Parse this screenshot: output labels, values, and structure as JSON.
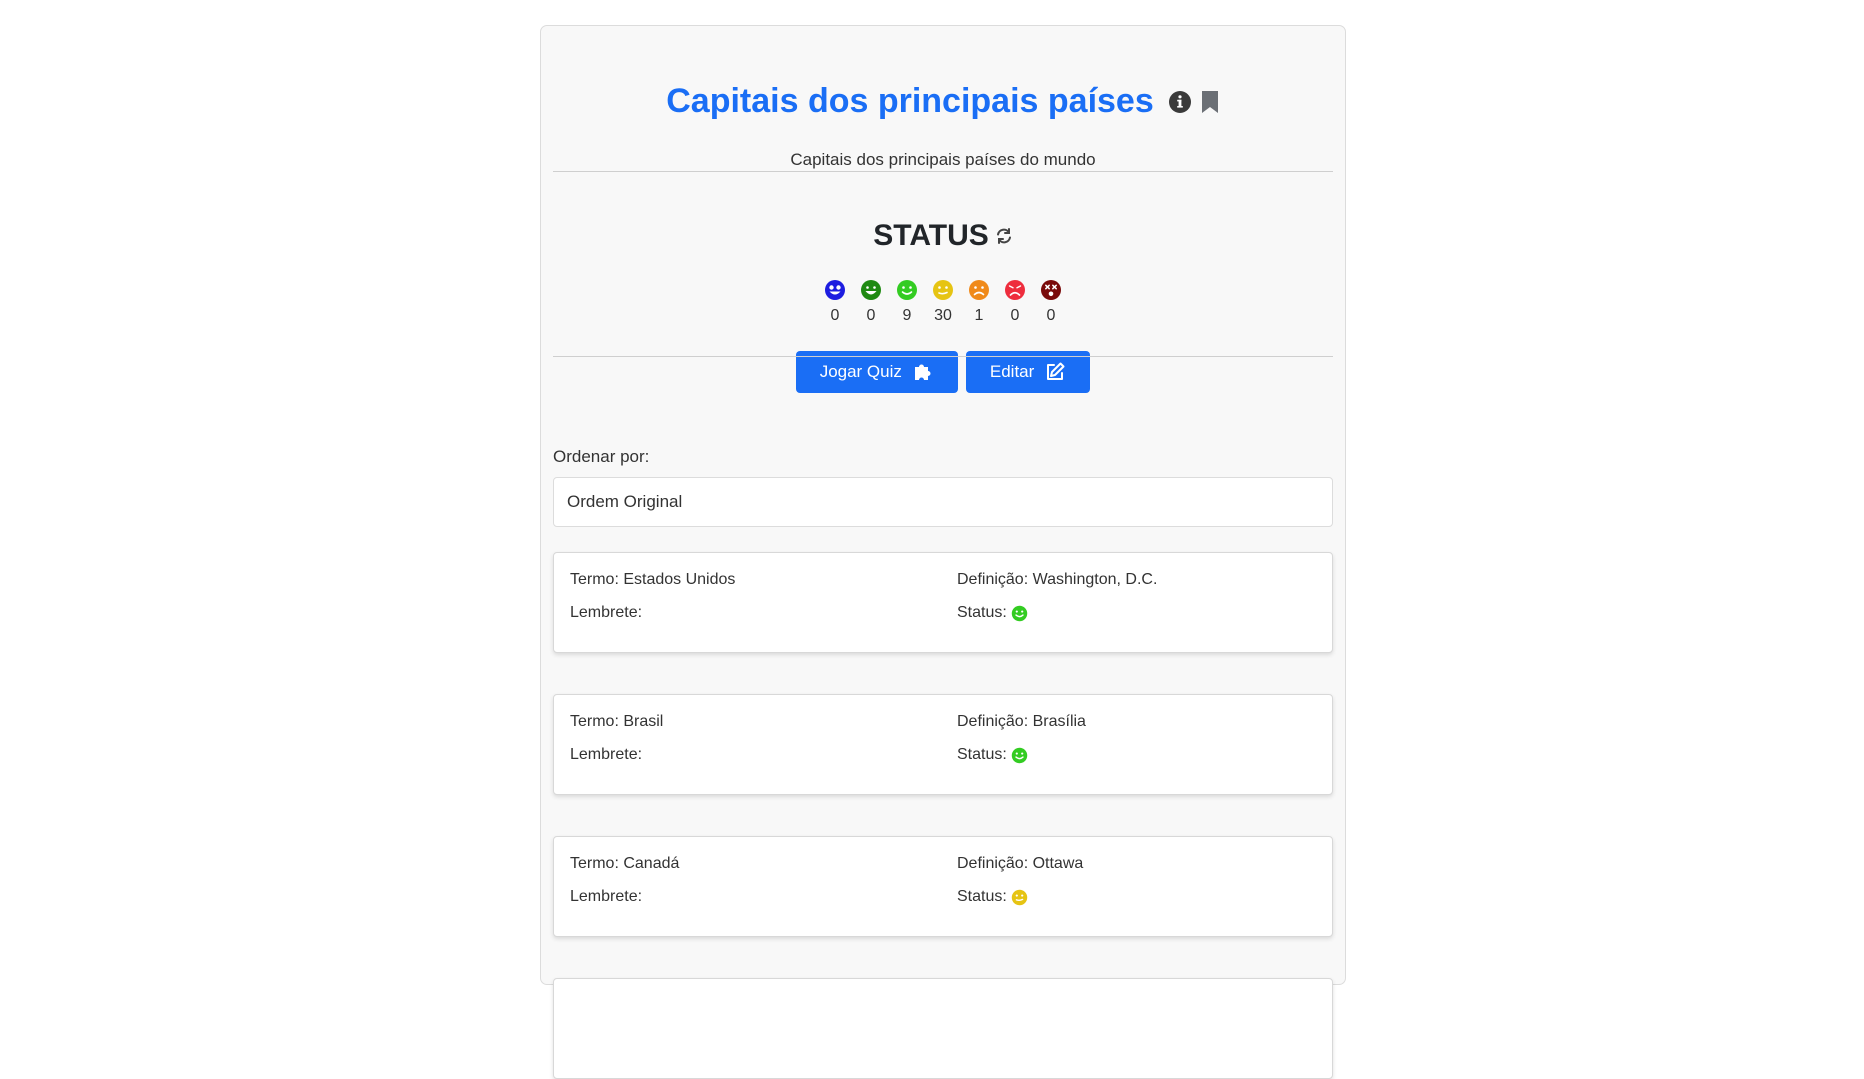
{
  "header": {
    "title": "Capitais dos principais países",
    "subtitle": "Capitais dos principais países do mundo"
  },
  "status": {
    "heading": "STATUS",
    "faces": [
      {
        "icon": "grinning-star-eyes-face-icon",
        "color": "#1d1de0",
        "count": "0"
      },
      {
        "icon": "big-grin-face-icon",
        "color": "#1f8a12",
        "count": "0"
      },
      {
        "icon": "smile-face-icon",
        "color": "#33cc22",
        "count": "9"
      },
      {
        "icon": "neutral-face-icon",
        "color": "#e6c413",
        "count": "30"
      },
      {
        "icon": "frown-face-icon",
        "color": "#f08a1a",
        "count": "1"
      },
      {
        "icon": "sad-face-icon",
        "color": "#ee2d3d",
        "count": "0"
      },
      {
        "icon": "dizzy-face-icon",
        "color": "#7a0a0a",
        "count": "0"
      }
    ]
  },
  "buttons": {
    "play_quiz": "Jogar Quiz",
    "edit": "Editar"
  },
  "sort": {
    "label": "Ordenar por:",
    "selected": "Ordem Original"
  },
  "cards": [
    {
      "termo_label": "Termo: Estados Unidos",
      "definicao_label": "Definição: Washington, D.C.",
      "lembrete_label": "Lembrete:",
      "status_label": "Status:",
      "status_icon": "smile-face-icon"
    },
    {
      "termo_label": "Termo: Brasil",
      "definicao_label": "Definição: Brasília",
      "lembrete_label": "Lembrete:",
      "status_label": "Status:",
      "status_icon": "smile-face-icon"
    },
    {
      "termo_label": "Termo: Canadá",
      "definicao_label": "Definição: Ottawa",
      "lembrete_label": "Lembrete:",
      "status_label": "Status:",
      "status_icon": "neutral-face-icon"
    }
  ],
  "colors": {
    "accent": "#1a6ef5",
    "panel_bg": "#f8f8f8"
  }
}
